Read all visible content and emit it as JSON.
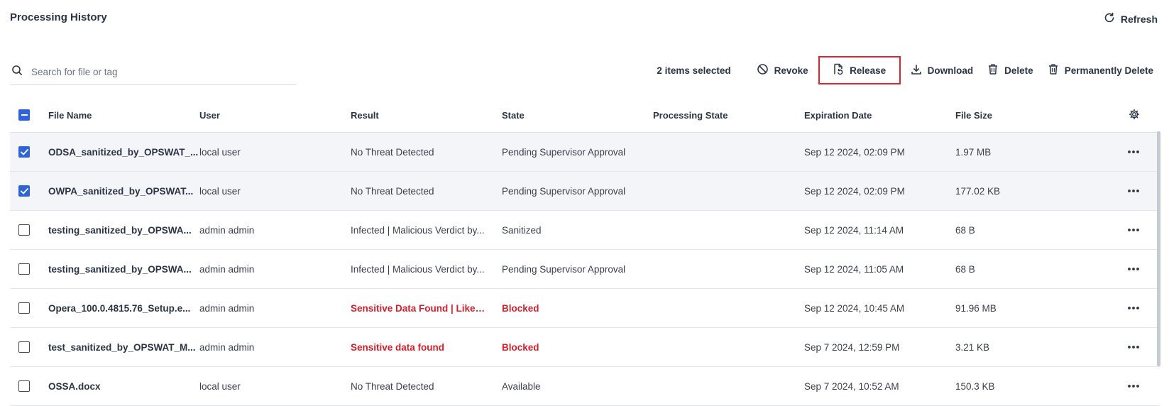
{
  "header": {
    "title": "Processing History",
    "refresh_label": "Refresh"
  },
  "search": {
    "placeholder": "Search for file or tag",
    "value": ""
  },
  "toolbar": {
    "selected_text": "2 items selected",
    "revoke_label": "Revoke",
    "release_label": "Release",
    "download_label": "Download",
    "delete_label": "Delete",
    "permanently_delete_label": "Permanently Delete"
  },
  "table": {
    "columns": [
      "File Name",
      "User",
      "Result",
      "State",
      "Processing State",
      "Expiration Date",
      "File Size"
    ],
    "rows": [
      {
        "checked": true,
        "name": "ODSA_sanitized_by_OPSWAT_...",
        "user": "local user",
        "result": "No Threat Detected",
        "state": "Pending Supervisor Approval",
        "processing_state": "",
        "expiration": "Sep 12 2024, 02:09 PM",
        "size": "1.97 MB",
        "danger": false
      },
      {
        "checked": true,
        "name": "OWPA_sanitized_by_OPSWAT...",
        "user": "local user",
        "result": "No Threat Detected",
        "state": "Pending Supervisor Approval",
        "processing_state": "",
        "expiration": "Sep 12 2024, 02:09 PM",
        "size": "177.02 KB",
        "danger": false
      },
      {
        "checked": false,
        "name": "testing_sanitized_by_OPSWA...",
        "user": "admin admin",
        "result": "Infected | Malicious Verdict by...",
        "state": "Sanitized",
        "processing_state": "",
        "expiration": "Sep 12 2024, 11:14 AM",
        "size": "68 B",
        "danger": false
      },
      {
        "checked": false,
        "name": "testing_sanitized_by_OPSWA...",
        "user": "admin admin",
        "result": "Infected | Malicious Verdict by...",
        "state": "Pending Supervisor Approval",
        "processing_state": "",
        "expiration": "Sep 12 2024, 11:05 AM",
        "size": "68 B",
        "danger": false
      },
      {
        "checked": false,
        "name": "Opera_100.0.4815.76_Setup.e...",
        "user": "admin admin",
        "result": "Sensitive Data Found | Likely ...",
        "state": "Blocked",
        "processing_state": "",
        "expiration": "Sep 12 2024, 10:45 AM",
        "size": "91.96 MB",
        "danger": true
      },
      {
        "checked": false,
        "name": "test_sanitized_by_OPSWAT_M...",
        "user": "admin admin",
        "result": "Sensitive data found",
        "state": "Blocked",
        "processing_state": "",
        "expiration": "Sep 7 2024, 12:59 PM",
        "size": "3.21 KB",
        "danger": true
      },
      {
        "checked": false,
        "name": "OSSA.docx",
        "user": "local user",
        "result": "No Threat Detected",
        "state": "Available",
        "processing_state": "",
        "expiration": "Sep 7 2024, 10:52 AM",
        "size": "150.3 KB",
        "danger": false
      }
    ]
  },
  "colors": {
    "accent": "#2f63d8",
    "danger": "#d21f2a",
    "highlight_border": "#e0232e"
  }
}
